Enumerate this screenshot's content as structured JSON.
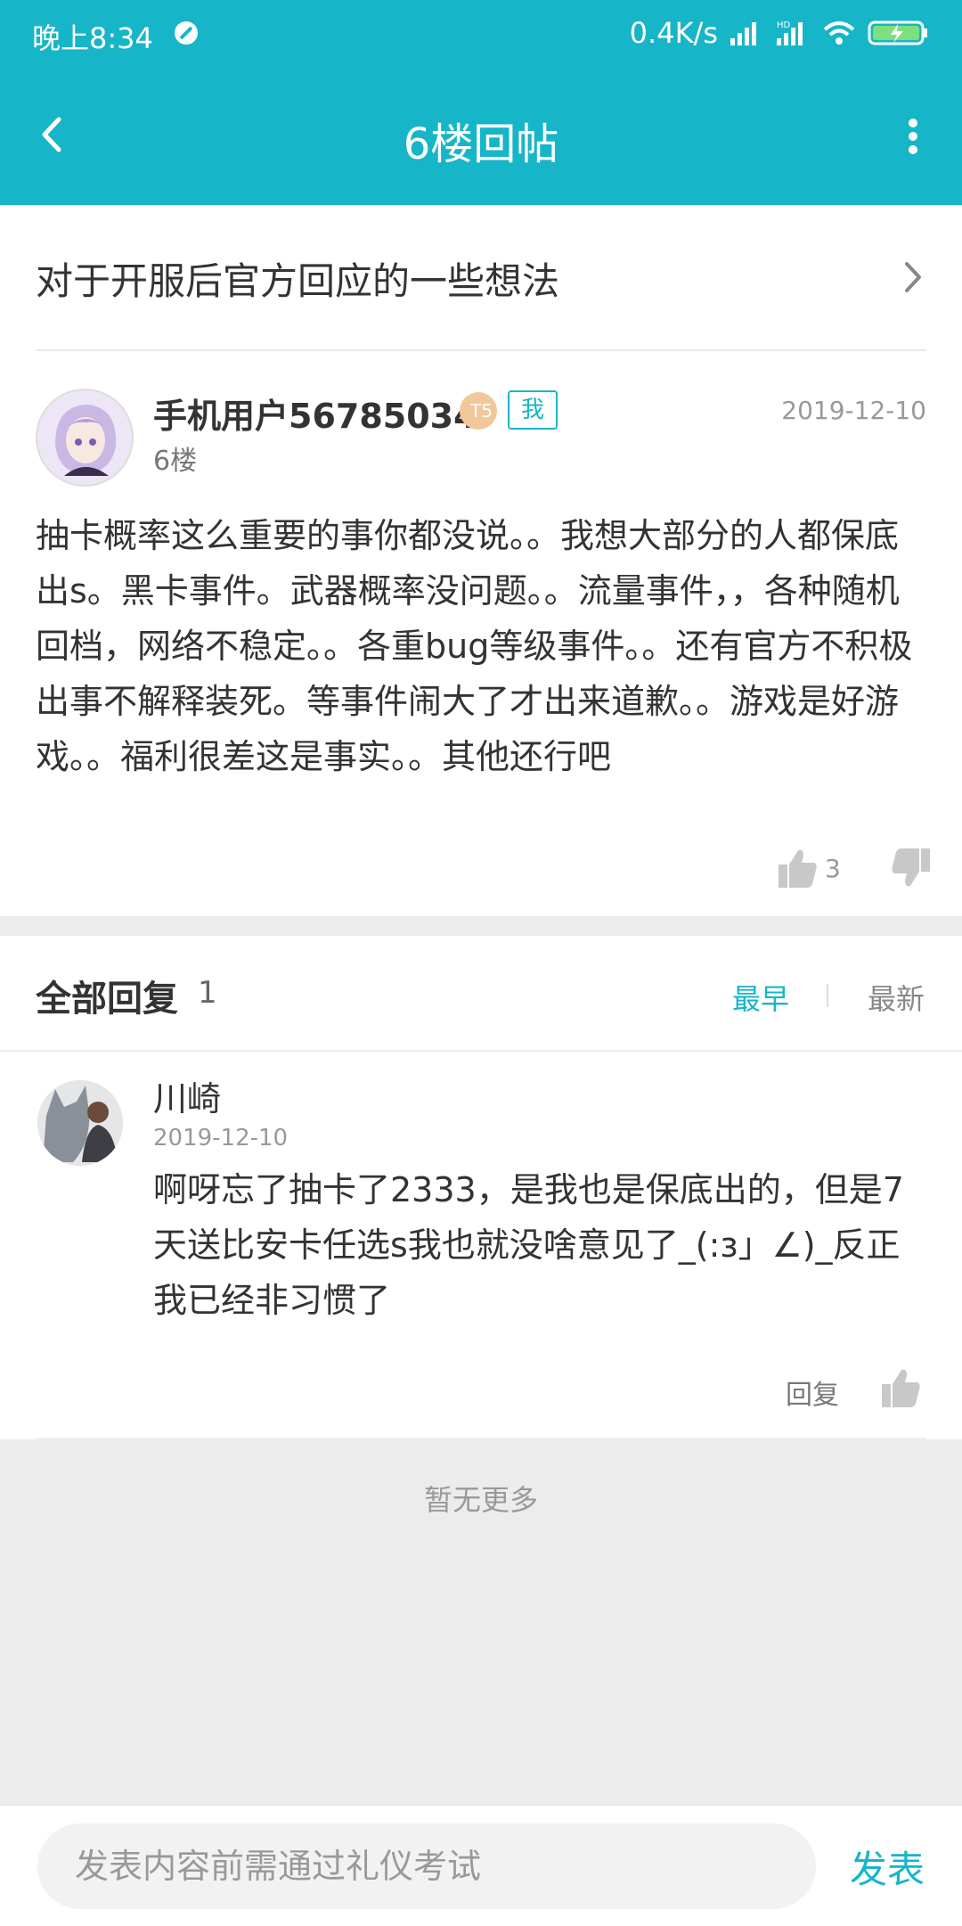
{
  "status_bar": {
    "time": "晚上8:34",
    "net_speed": "0.4K/s",
    "hd_label": "HD"
  },
  "nav": {
    "title": "6楼回帖"
  },
  "thread": {
    "title": "对于开服后官方回应的一些想法"
  },
  "post": {
    "author": "手机用户56785034",
    "level_badge": "T5",
    "me_tag": "我",
    "floor": "6楼",
    "date": "2019-12-10",
    "body": "抽卡概率这么重要的事你都没说。。我想大部分的人都保底出s。黑卡事件。武器概率没问题。。流量事件，，各种随机回档，网络不稳定。。各重bug等级事件。。还有官方不积极出事不解释装死。等事件闹大了才出来道歉。。游戏是好游戏。。福利很差这是事实。。其他还行吧",
    "likes": "3"
  },
  "replies_section": {
    "title": "全部回复",
    "count": "1",
    "sort_earliest": "最早",
    "sort_latest": "最新"
  },
  "reply": {
    "author": "川崎",
    "date": "2019-12-10",
    "body": "啊呀忘了抽卡了2333，是我也是保底出的，但是7天送比安卡任选s我也就没啥意见了_(:з」∠)_反正我已经非习惯了",
    "action": "回复"
  },
  "footer_note": "暂无更多",
  "composer": {
    "placeholder": "发表内容前需通过礼仪考试",
    "send_label": "发表"
  },
  "colors": {
    "accent": "#17b5c8",
    "page_bg": "#ececec"
  }
}
